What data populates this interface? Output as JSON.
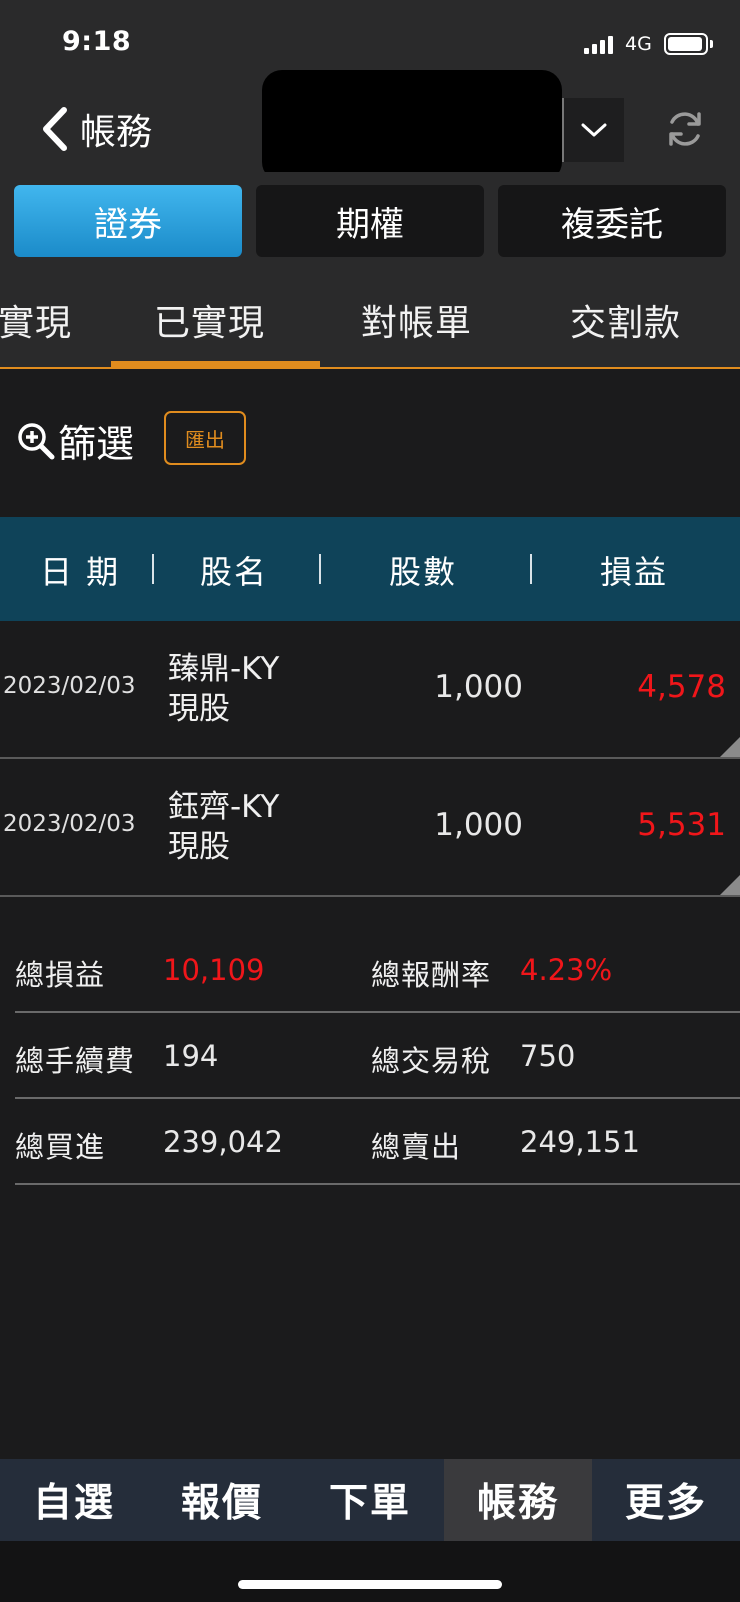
{
  "status_bar": {
    "time": "9:18",
    "network": "4G"
  },
  "header": {
    "back_label": "帳務"
  },
  "segments": [
    {
      "label": "證券",
      "active": true
    },
    {
      "label": "期權",
      "active": false
    },
    {
      "label": "複委託",
      "active": false
    }
  ],
  "subtabs": [
    {
      "label": "實現",
      "active": false
    },
    {
      "label": "已實現",
      "active": true
    },
    {
      "label": "對帳單",
      "active": false
    },
    {
      "label": "交割款",
      "active": false
    }
  ],
  "filter": {
    "label": "篩選",
    "export_label": "匯出"
  },
  "table": {
    "headers": [
      "日 期",
      "股名",
      "股數",
      "損益"
    ],
    "rows": [
      {
        "date": "2023/02/03",
        "name": "臻鼎-KY",
        "type": "現股",
        "qty": "1,000",
        "pl": "4,578"
      },
      {
        "date": "2023/02/03",
        "name": "鈺齊-KY",
        "type": "現股",
        "qty": "1,000",
        "pl": "5,531"
      }
    ]
  },
  "summary": [
    {
      "left_label": "總損益",
      "left_value": "10,109",
      "right_label": "總報酬率",
      "right_value": "4.23%"
    },
    {
      "left_label": "總手續費",
      "left_value": "194",
      "right_label": "總交易稅",
      "right_value": "750"
    },
    {
      "left_label": "總買進",
      "left_value": "239,042",
      "right_label": "總賣出",
      "right_value": "249,151"
    }
  ],
  "tabbar": [
    {
      "label": "自選",
      "active": false
    },
    {
      "label": "報價",
      "active": false
    },
    {
      "label": "下單",
      "active": false
    },
    {
      "label": "帳務",
      "active": true
    },
    {
      "label": "更多",
      "active": false
    }
  ],
  "colors": {
    "accent": "#e08c1e",
    "active_segment": "#2aa0dc",
    "header_row": "#0f4359",
    "profit": "#f0161a"
  }
}
